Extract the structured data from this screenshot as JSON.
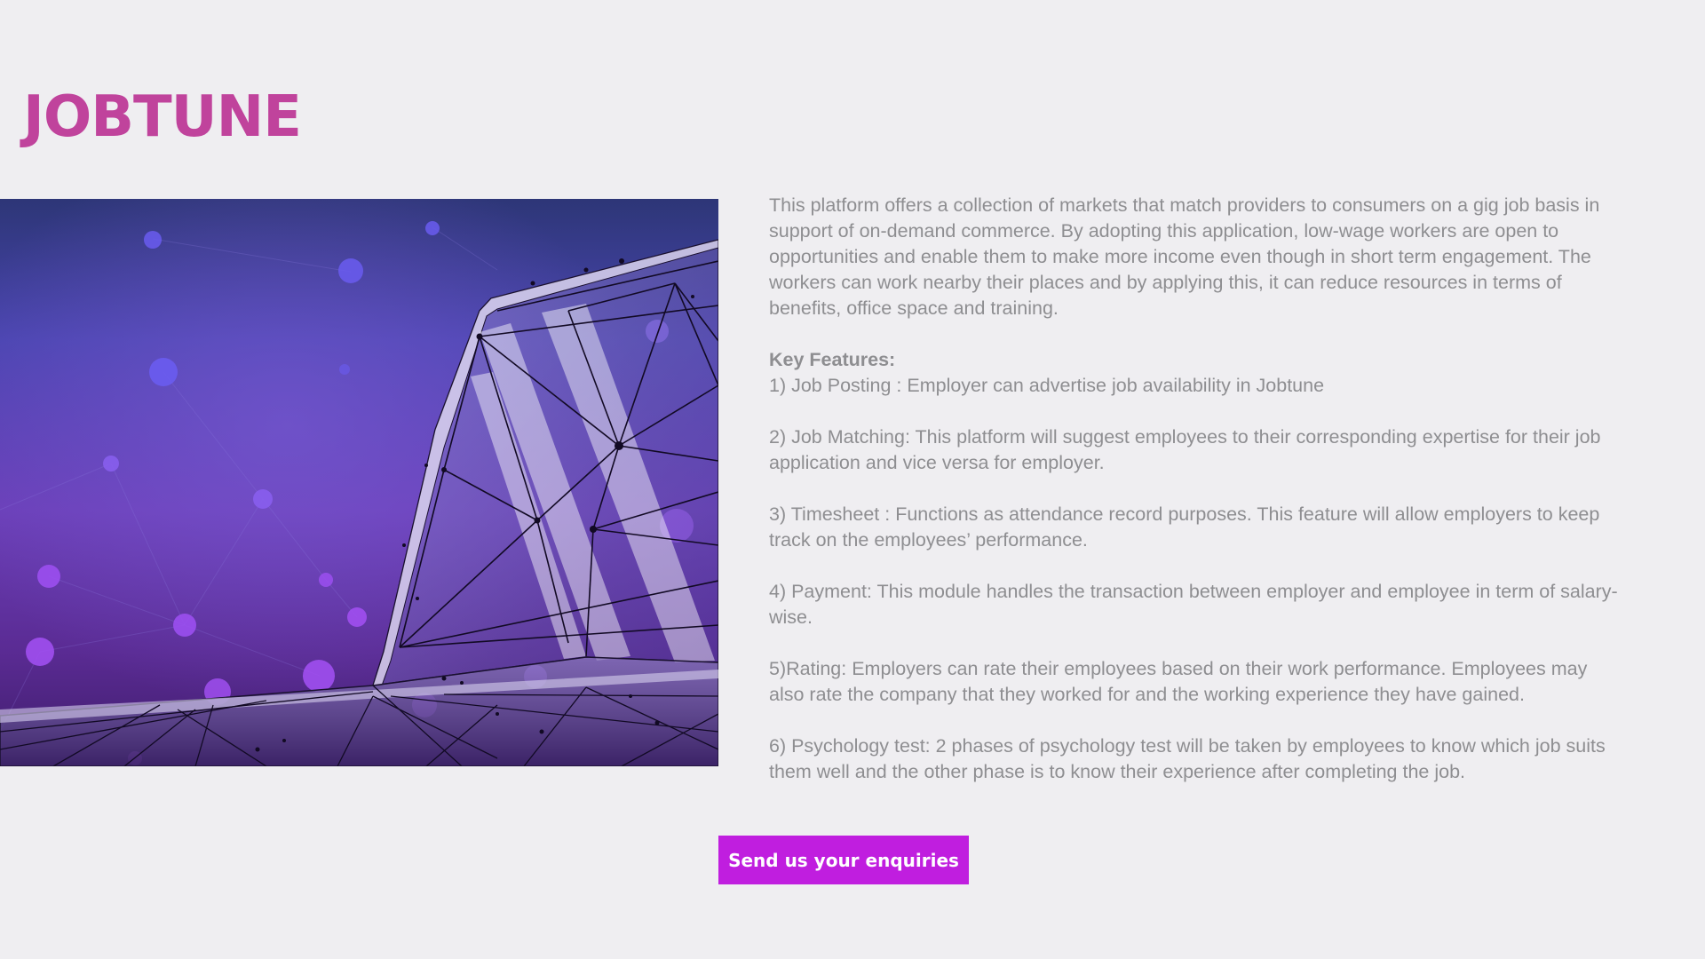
{
  "brand": {
    "title": "JOBTUNE"
  },
  "colors": {
    "brand_pink": "#c0439c",
    "button_purple": "#c01edf",
    "body_text": "#8e8e91",
    "page_background": "#efeef1"
  },
  "hero": {
    "image_name": "wireframe-laptop-illustration"
  },
  "description": {
    "intro": "This platform offers a collection of markets that match providers to consumers on a gig job basis in support of on-demand commerce. By adopting this application, low-wage workers are open to opportunities and enable them to make more income even though in short term engagement. The workers can work nearby their places and by applying this, it can reduce resources in terms of benefits, office space and training.",
    "features_heading": "Key Features:",
    "features": [
      "1) Job Posting : Employer can advertise job availability in Jobtune",
      "2) Job Matching: This platform will  suggest employees to their corresponding expertise for their job application and vice versa for employer.",
      "3) Timesheet : Functions as attendance record purposes. This feature will allow employers to keep track on the employees’ performance.",
      "4) Payment: This module handles the transaction between employer and employee in term of salary-wise.",
      "5)Rating: Employers can rate their employees based on their work performance. Employees may also rate the company that they worked for and the working experience they have gained.",
      "6) Psychology test: 2 phases of psychology test will be taken by employees to know which job suits them well and the other phase is to know their experience after completing the job."
    ]
  },
  "cta": {
    "label": "Send us your enquiries"
  }
}
